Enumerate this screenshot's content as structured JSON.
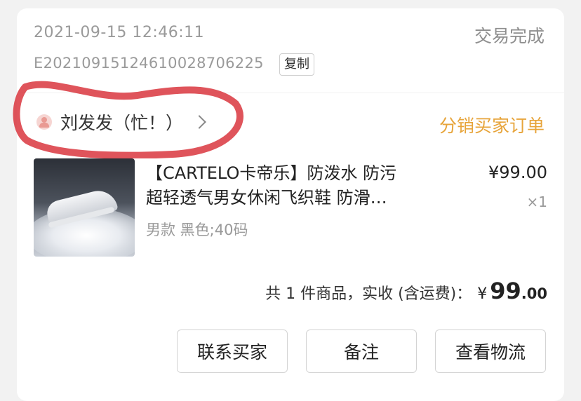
{
  "order": {
    "datetime": "2021-09-15 12:46:11",
    "status": "交易完成",
    "order_number": "E20210915124610028706225",
    "copy_label": "复制"
  },
  "buyer": {
    "name": "刘发发（忙！）",
    "icon": "user-icon",
    "tag": "分销买家订单",
    "tag_color": "#e7a43a"
  },
  "product": {
    "title_line1": "【CARTELO卡帝乐】防泼水 防污",
    "title_line2": "超轻透气男女休闲飞织鞋  防滑…",
    "spec": "男款 黑色;40码",
    "price": "¥99.00",
    "quantity": "×1"
  },
  "summary": {
    "text": "共 1 件商品，实收 (含运费)：",
    "currency": "¥",
    "amount_int": "99",
    "amount_dec": ".00"
  },
  "actions": {
    "contact": "联系买家",
    "note": "备注",
    "logistics": "查看物流"
  },
  "annotation_color": "#d9363e"
}
